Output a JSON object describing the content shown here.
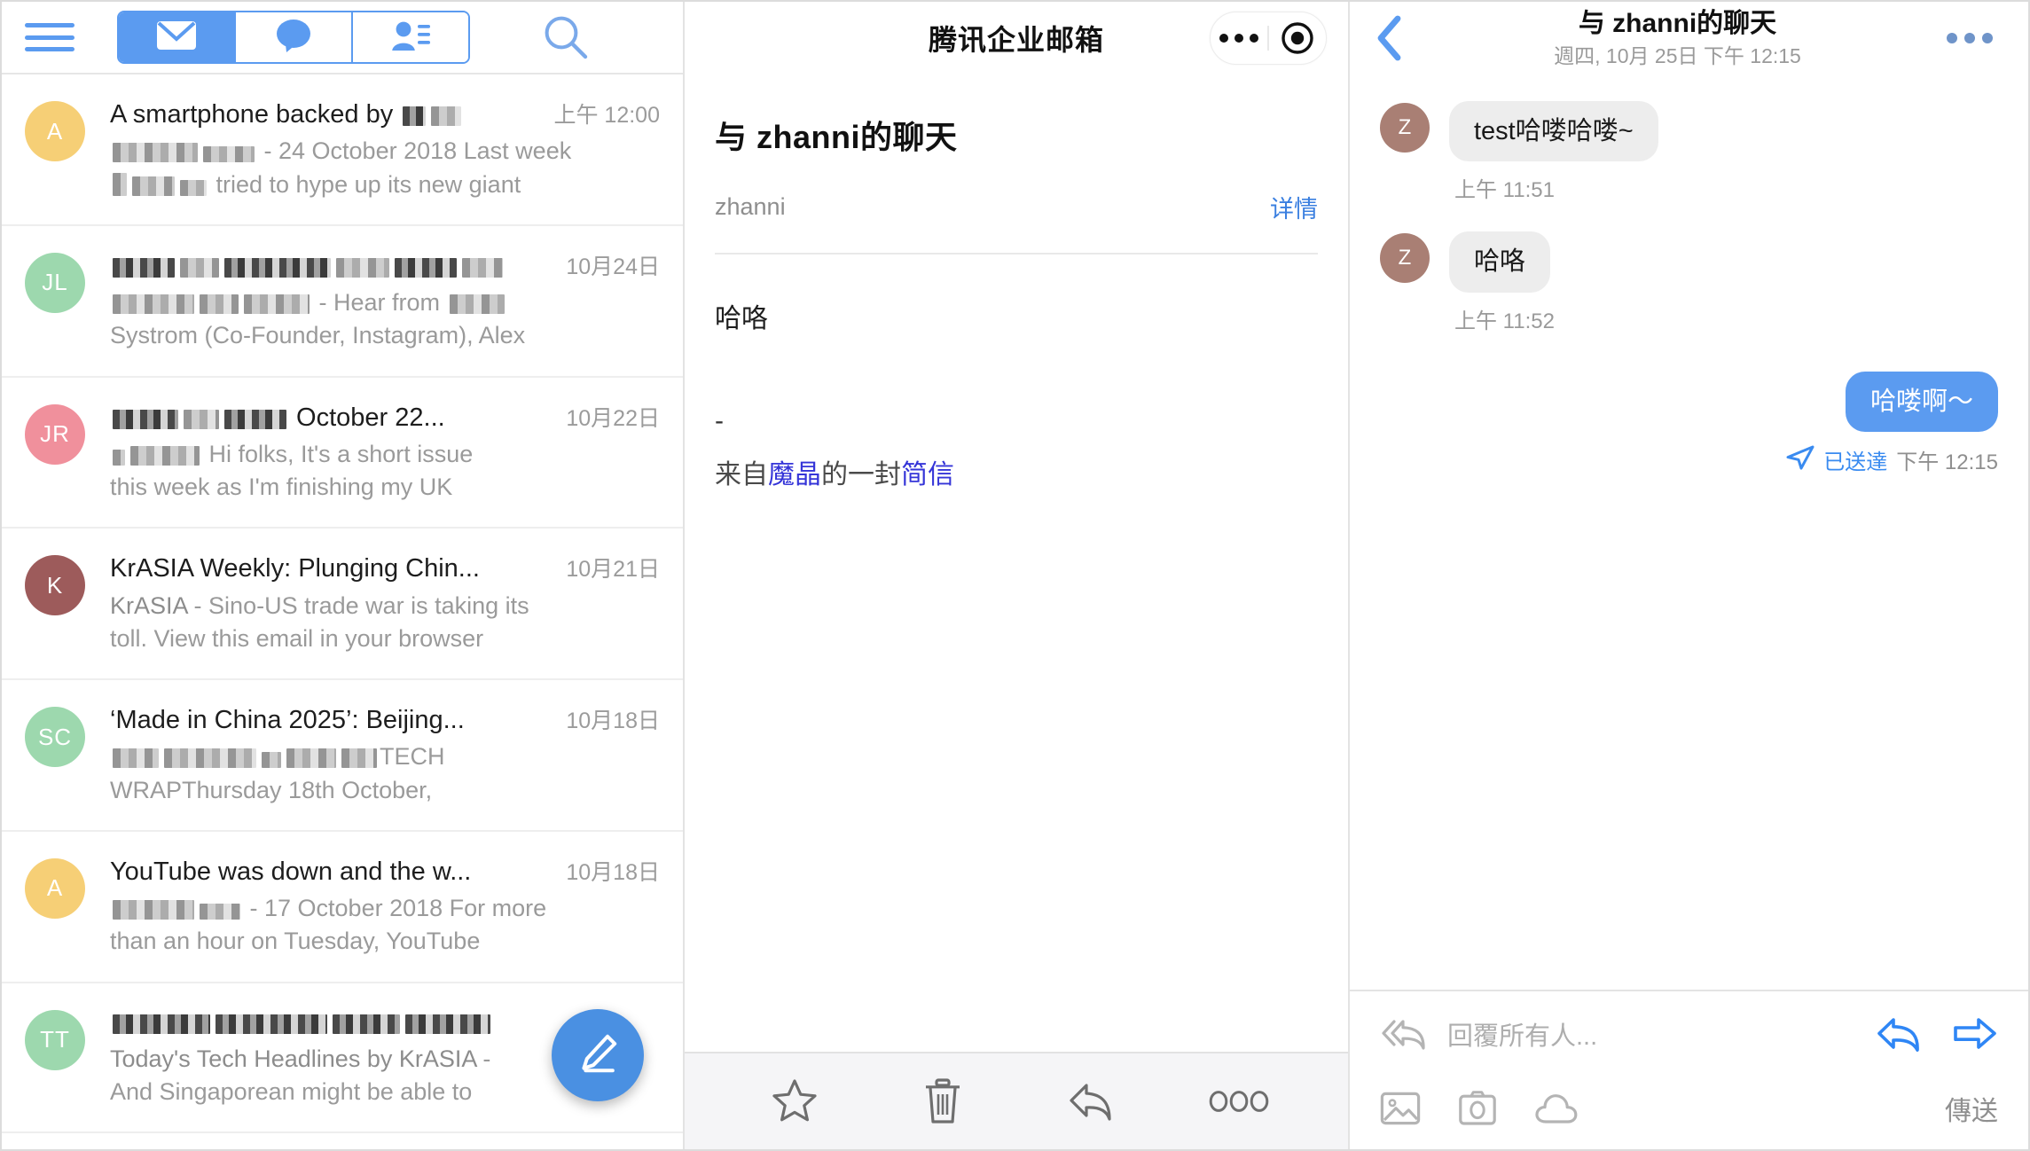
{
  "mail_list": {
    "header": {
      "menu_icon": "hamburger-icon",
      "tabs": [
        {
          "name": "mail",
          "icon": "envelope-icon",
          "active": true
        },
        {
          "name": "chat",
          "icon": "speech-bubble-icon",
          "active": false
        },
        {
          "name": "contacts",
          "icon": "contact-card-icon",
          "active": false
        }
      ],
      "search_icon": "search-icon"
    },
    "items": [
      {
        "avatar": "A",
        "avatar_color": "#f6cf76",
        "subject": "A smartphone backed by ",
        "subject_redacted": true,
        "date": "上午 12:00",
        "snippet_pre_redacted": true,
        "snippet": " - 24 October 2018 Last week",
        "snippet2": " tried to hype up its new giant"
      },
      {
        "avatar": "JL",
        "avatar_color": "#9dd8ae",
        "subject": "",
        "subject_redacted": true,
        "date": "10月24日",
        "snippet_pre_redacted": true,
        "snippet": " - Hear from ",
        "snippet2": "Systrom (Co-Founder, Instagram), Alex"
      },
      {
        "avatar": "JR",
        "avatar_color": "#f0909c",
        "subject": " October 22...",
        "subject_redacted": true,
        "date": "10月22日",
        "snippet_pre_redacted": true,
        "snippet": " Hi folks, It's a short issue",
        "snippet2": "this week as I'm finishing my UK"
      },
      {
        "avatar": "K",
        "avatar_color": "#9d5b5b",
        "subject": "KrASIA Weekly: Plunging Chin...",
        "subject_redacted": false,
        "date": "10月21日",
        "snippet_pre_redacted": false,
        "snippet_bold": "KrASIA",
        "snippet": " - Sino-US trade war is taking its",
        "snippet2": "toll. View this email in your browser"
      },
      {
        "avatar": "SC",
        "avatar_color": "#9dd8ae",
        "subject": "‘Made in China 2025’: Beijing...",
        "subject_redacted": false,
        "date": "10月18日",
        "snippet_pre_redacted": true,
        "snippet": "TECH",
        "snippet2": "WRAPThursday 18th October,"
      },
      {
        "avatar": "A",
        "avatar_color": "#f6cf76",
        "subject": "YouTube was down and the w...",
        "subject_redacted": false,
        "date": "10月18日",
        "snippet_pre_redacted": true,
        "snippet": " - 17 October 2018 For more",
        "snippet2": "than an hour on Tuesday, YouTube"
      },
      {
        "avatar": "TT",
        "avatar_color": "#9dd8ae",
        "subject": "",
        "subject_redacted": true,
        "date": "",
        "snippet_pre_redacted": false,
        "snippet_bold": "Today's Tech Headlines by KrASIA",
        "snippet": " -",
        "snippet2": "And Singaporean might be able to"
      }
    ],
    "compose_fab": "compose-pencil-icon"
  },
  "mail_detail": {
    "header_title": "腾讯企业邮箱",
    "capsule": {
      "more": "more-dots-icon",
      "target": "target-circle-icon"
    },
    "subject": "与 zhanni的聊天",
    "from": "zhanni",
    "details_label": "详情",
    "body": "哈咯",
    "signature_dash": "-",
    "signature_prefix": "来自",
    "signature_link1": "魔晶",
    "signature_mid": "的一封",
    "signature_link2": "简信",
    "toolbar": [
      {
        "name": "star-icon",
        "label": "star"
      },
      {
        "name": "trash-icon",
        "label": "delete"
      },
      {
        "name": "reply-icon",
        "label": "reply"
      },
      {
        "name": "more-horizontal-icon",
        "label": "more"
      }
    ]
  },
  "chat": {
    "back_icon": "chevron-left-icon",
    "title": "与 zhanni的聊天",
    "subtitle": "週四, 10月 25日 下午 12:15",
    "more_icon": "more-dots-icon",
    "messages": [
      {
        "direction": "in",
        "avatar": "Z",
        "text": "test哈喽哈喽~",
        "time": "上午 11:51"
      },
      {
        "direction": "in",
        "avatar": "Z",
        "text": "哈咯",
        "time": "上午 11:52"
      },
      {
        "direction": "out",
        "text": "哈喽啊～",
        "status": "已送達",
        "time": "下午 12:15",
        "status_icon": "paper-plane-icon"
      }
    ],
    "composer": {
      "reply_all_icon": "reply-all-icon",
      "placeholder": "回覆所有人...",
      "reply_icon": "reply-arrow-icon",
      "forward_icon": "forward-arrow-icon",
      "image_icon": "image-icon",
      "camera_icon": "camera-icon",
      "cloud_icon": "cloud-icon",
      "send_label": "傳送"
    }
  },
  "colors": {
    "accent_blue": "#5b9bf0",
    "link_blue": "#3a7fe0",
    "bubble_gray": "#ededed",
    "sig_link": "#3535d8"
  }
}
